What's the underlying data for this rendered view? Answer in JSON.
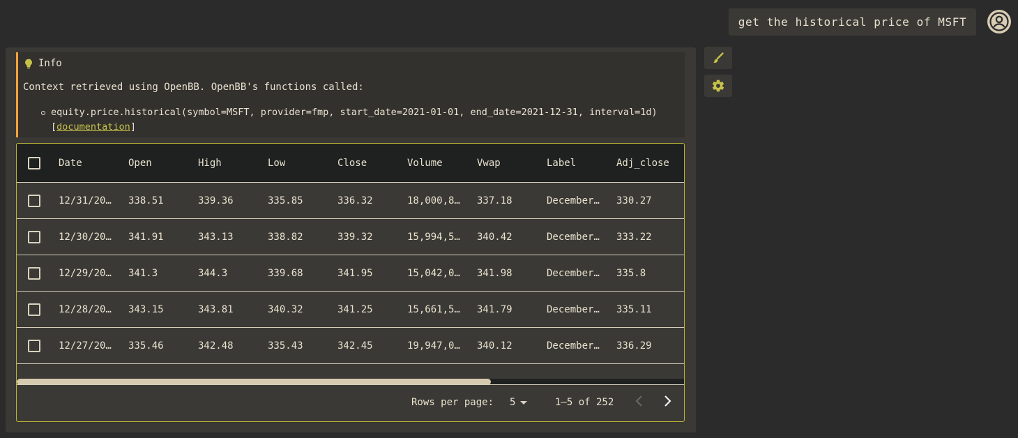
{
  "user_message": "get the historical price of MSFT",
  "info": {
    "title": "Info",
    "text": "Context retrieved using OpenBB. OpenBB's functions called:",
    "call": "equity.price.historical(symbol=MSFT, provider=fmp, start_date=2021-01-01, end_date=2021-12-31, interval=1d)",
    "link_open": "[",
    "link_text": "documentation",
    "link_close": "]"
  },
  "table": {
    "columns": [
      "Date",
      "Open",
      "High",
      "Low",
      "Close",
      "Volume",
      "Vwap",
      "Label",
      "Adj_close"
    ],
    "rows": [
      [
        "12/31/20…",
        "338.51",
        "339.36",
        "335.85",
        "336.32",
        "18,000,8…",
        "337.18",
        "December…",
        "330.27"
      ],
      [
        "12/30/20…",
        "341.91",
        "343.13",
        "338.82",
        "339.32",
        "15,994,5…",
        "340.42",
        "December…",
        "333.22"
      ],
      [
        "12/29/20…",
        "341.3",
        "344.3",
        "339.68",
        "341.95",
        "15,042,0…",
        "341.98",
        "December…",
        "335.8"
      ],
      [
        "12/28/20…",
        "343.15",
        "343.81",
        "340.32",
        "341.25",
        "15,661,5…",
        "341.79",
        "December…",
        "335.11"
      ],
      [
        "12/27/20…",
        "335.46",
        "342.48",
        "335.43",
        "342.45",
        "19,947,0…",
        "340.12",
        "December…",
        "336.29"
      ]
    ]
  },
  "pagination": {
    "rows_per_page_label": "Rows per page:",
    "rows_per_page_value": "5",
    "range": "1–5 of 252"
  },
  "icons": {
    "avatar": "account-circle-icon",
    "info": "lightbulb-icon",
    "side_1": "brush-icon",
    "side_2": "gear-icon"
  },
  "colors": {
    "accent": "#c7c24a",
    "info_border": "#f2a33c",
    "background": "#2b2b2b",
    "panel": "#3b3935"
  }
}
